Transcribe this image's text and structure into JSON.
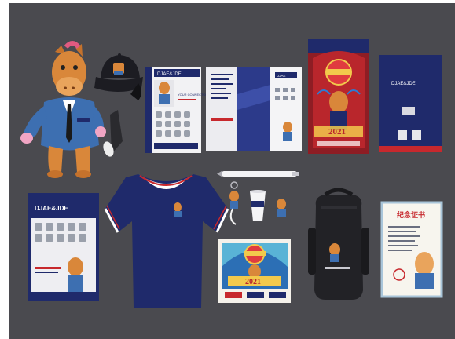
{
  "scene": {
    "background": "#4a4a4f",
    "frame": "#ffffff",
    "navy": "#1f2a6b",
    "red": "#c7282d",
    "cream": "#e8dcc4"
  },
  "brand": {
    "logo_text": "DJAE&JDE",
    "logo_small": "DJAE",
    "brochure_title": "DJAE&JDE",
    "brochure_subtitle": "YOUR CONNECTOR",
    "year": "2021",
    "certificate_title": "纪念证书",
    "envelope_logo": "DJAE&JDE"
  },
  "items": [
    {
      "name": "plush-horse-mascot"
    },
    {
      "name": "navy-cap"
    },
    {
      "name": "catalog-booklet"
    },
    {
      "name": "trifold-brochure"
    },
    {
      "name": "red-envelope-2021"
    },
    {
      "name": "navy-envelope"
    },
    {
      "name": "poster-catalog"
    },
    {
      "name": "polo-shirt"
    },
    {
      "name": "pen"
    },
    {
      "name": "keychain"
    },
    {
      "name": "cup"
    },
    {
      "name": "pin-badge"
    },
    {
      "name": "mousepad-2021"
    },
    {
      "name": "backpack"
    },
    {
      "name": "certificate"
    }
  ]
}
